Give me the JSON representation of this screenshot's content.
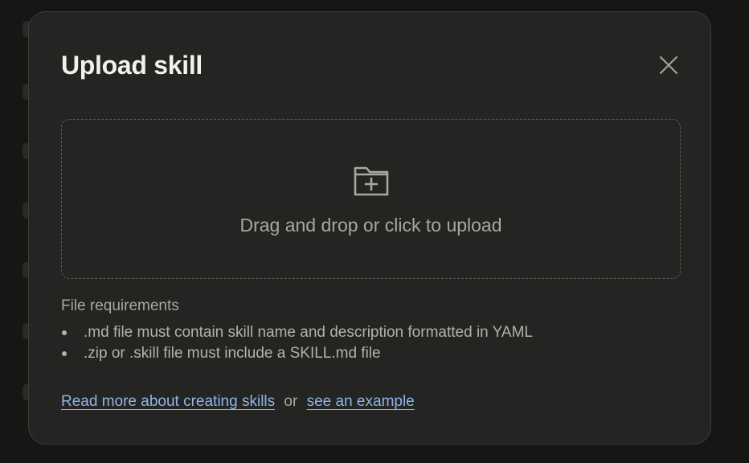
{
  "modal": {
    "title": "Upload skill",
    "close_icon": "close-icon"
  },
  "dropzone": {
    "icon": "folder-plus-icon",
    "text": "Drag and drop or click to upload"
  },
  "requirements": {
    "heading": "File requirements",
    "items": [
      ".md file must contain skill name and description formatted in YAML",
      ".zip or .skill file must include a SKILL.md file"
    ]
  },
  "footer_links": {
    "read_more": "Read more about creating skills",
    "separator": "or",
    "example": "see an example"
  },
  "colors": {
    "modal_bg": "#242423",
    "backdrop": "#161615",
    "title": "#f3f1ea",
    "muted_text": "#a9a79f",
    "link": "#8fb4e8",
    "dashed_border": "#5a5a56"
  }
}
